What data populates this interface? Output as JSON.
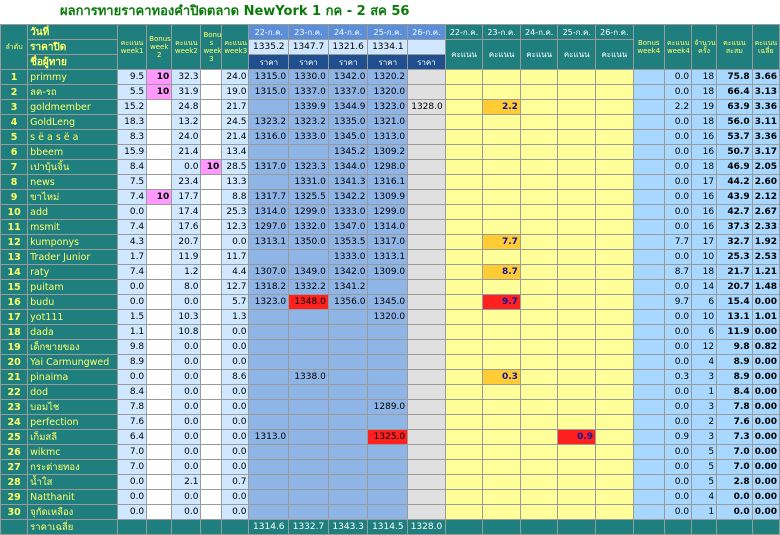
{
  "title": "ผลการทายราคาทองคำปิดตลาด NewYork 1 กค - 2 สค 56",
  "header": {
    "col_index": "ลำดับ",
    "row1_label": "วันที่",
    "row2_label": "ราคาปิด",
    "row3_label": "ชื่อผู้ทาย",
    "score_w1": "คะแนน week1",
    "bonus_w2": "Bonus week 2",
    "score_w2": "คะแนน week2",
    "bonus_w3": "Bonu s week 3",
    "score_w3": "คะแนน week3",
    "dates_w4": [
      "22-ก.ค.",
      "23-ก.ค.",
      "24-ก.ค.",
      "25-ก.ค.",
      "26-ก.ค."
    ],
    "close_w4": [
      "1335.2",
      "1347.7",
      "1321.6",
      "1334.1",
      ""
    ],
    "price_label": "ราคา",
    "dates_w5": [
      "22-ก.ค.",
      "23-ก.ค.",
      "24-ก.ค.",
      "25-ก.ค.",
      "26-ก.ค."
    ],
    "score_label": "คะแนน",
    "bonus_w4": "Bonus week4",
    "score_w4": "คะแนน week4",
    "count": "จำนวน ครั้ง",
    "total": "คะแนน สะสม",
    "avg": "คะแนน เฉลี่ย"
  },
  "rows": [
    {
      "n": "1",
      "name": "primmy",
      "w1": "9.5",
      "b2": "10",
      "w2": "32.3",
      "b3": "",
      "w3": "24.0",
      "p": [
        "1315.0",
        "1330.0",
        "1342.0",
        "1320.2",
        ""
      ],
      "s": [
        "",
        "",
        "",
        "",
        ""
      ],
      "b4": "",
      "w4": "0.0",
      "c": "18",
      "t": "75.8",
      "a": "3.66"
    },
    {
      "n": "2",
      "name": "ลค-รถ",
      "w1": "5.5",
      "b2": "10",
      "w2": "31.9",
      "b3": "",
      "w3": "19.0",
      "p": [
        "1315.0",
        "1337.0",
        "1337.0",
        "1320.0",
        ""
      ],
      "s": [
        "",
        "",
        "",
        "",
        ""
      ],
      "b4": "",
      "w4": "0.0",
      "c": "18",
      "t": "66.4",
      "a": "3.13"
    },
    {
      "n": "3",
      "name": "goldmember",
      "w1": "15.2",
      "b2": "",
      "w2": "24.8",
      "b3": "",
      "w3": "21.7",
      "p": [
        "",
        "1339.9",
        "1344.9",
        "1323.0",
        "1328.0"
      ],
      "s": [
        "",
        "2.2",
        "",
        "",
        ""
      ],
      "b4": "",
      "w4": "2.2",
      "c": "19",
      "t": "63.9",
      "a": "3.36"
    },
    {
      "n": "4",
      "name": "GoldLeng",
      "w1": "18.3",
      "b2": "",
      "w2": "13.2",
      "b3": "",
      "w3": "24.5",
      "p": [
        "1323.2",
        "1323.2",
        "1335.0",
        "1321.0",
        ""
      ],
      "s": [
        "",
        "",
        "",
        "",
        ""
      ],
      "b4": "",
      "w4": "0.0",
      "c": "18",
      "t": "56.0",
      "a": "3.11"
    },
    {
      "n": "5",
      "name": "s ë a s ë a",
      "w1": "8.3",
      "b2": "",
      "w2": "24.0",
      "b3": "",
      "w3": "21.4",
      "p": [
        "1316.0",
        "1333.0",
        "1345.0",
        "1313.0",
        ""
      ],
      "s": [
        "",
        "",
        "",
        "",
        ""
      ],
      "b4": "",
      "w4": "0.0",
      "c": "16",
      "t": "53.7",
      "a": "3.36"
    },
    {
      "n": "6",
      "name": "bbeem",
      "w1": "15.9",
      "b2": "",
      "w2": "21.4",
      "b3": "",
      "w3": "13.4",
      "p": [
        "",
        "",
        "1345.2",
        "1309.2",
        ""
      ],
      "s": [
        "",
        "",
        "",
        "",
        ""
      ],
      "b4": "",
      "w4": "0.0",
      "c": "16",
      "t": "50.7",
      "a": "3.17"
    },
    {
      "n": "7",
      "name": "เปาบุ้นจิ้น",
      "w1": "8.4",
      "b2": "",
      "w2": "0.0",
      "b3": "10",
      "w3": "28.5",
      "p": [
        "1317.0",
        "1323.3",
        "1344.0",
        "1298.0",
        ""
      ],
      "s": [
        "",
        "",
        "",
        "",
        ""
      ],
      "b4": "",
      "w4": "0.0",
      "c": "18",
      "t": "46.9",
      "a": "2.05"
    },
    {
      "n": "8",
      "name": "news",
      "w1": "7.5",
      "b2": "",
      "w2": "23.4",
      "b3": "",
      "w3": "13.3",
      "p": [
        "",
        "1331.0",
        "1341.3",
        "1316.1",
        ""
      ],
      "s": [
        "",
        "",
        "",
        "",
        ""
      ],
      "b4": "",
      "w4": "0.0",
      "c": "17",
      "t": "44.2",
      "a": "2.60"
    },
    {
      "n": "9",
      "name": "ขาไหม่",
      "w1": "7.4",
      "b2": "10",
      "w2": "17.7",
      "b3": "",
      "w3": "8.8",
      "p": [
        "1317.7",
        "1325.5",
        "1342.2",
        "1309.9",
        ""
      ],
      "s": [
        "",
        "",
        "",
        "",
        ""
      ],
      "b4": "",
      "w4": "0.0",
      "c": "16",
      "t": "43.9",
      "a": "2.12"
    },
    {
      "n": "10",
      "name": "add",
      "w1": "0.0",
      "b2": "",
      "w2": "17.4",
      "b3": "",
      "w3": "25.3",
      "p": [
        "1314.0",
        "1299.0",
        "1333.0",
        "1299.0",
        ""
      ],
      "s": [
        "",
        "",
        "",
        "",
        ""
      ],
      "b4": "",
      "w4": "0.0",
      "c": "16",
      "t": "42.7",
      "a": "2.67"
    },
    {
      "n": "11",
      "name": "msmit",
      "w1": "7.4",
      "b2": "",
      "w2": "17.6",
      "b3": "",
      "w3": "12.3",
      "p": [
        "1297.0",
        "1332.0",
        "1347.0",
        "1314.0",
        ""
      ],
      "s": [
        "",
        "",
        "",
        "",
        ""
      ],
      "b4": "",
      "w4": "0.0",
      "c": "16",
      "t": "37.3",
      "a": "2.33"
    },
    {
      "n": "12",
      "name": "kumponys",
      "w1": "4.3",
      "b2": "",
      "w2": "20.7",
      "b3": "",
      "w3": "0.0",
      "p": [
        "1313.1",
        "1350.0",
        "1353.5",
        "1317.0",
        ""
      ],
      "s": [
        "",
        "7.7",
        "",
        "",
        ""
      ],
      "b4": "",
      "w4": "7.7",
      "c": "17",
      "t": "32.7",
      "a": "1.92"
    },
    {
      "n": "13",
      "name": "Trader Junior",
      "w1": "1.7",
      "b2": "",
      "w2": "11.9",
      "b3": "",
      "w3": "11.7",
      "p": [
        "",
        "",
        "1333.0",
        "1313.1",
        ""
      ],
      "s": [
        "",
        "",
        "",
        "",
        ""
      ],
      "b4": "",
      "w4": "0.0",
      "c": "10",
      "t": "25.3",
      "a": "2.53"
    },
    {
      "n": "14",
      "name": "raty",
      "w1": "7.4",
      "b2": "",
      "w2": "1.2",
      "b3": "",
      "w3": "4.4",
      "p": [
        "1307.0",
        "1349.0",
        "1342.0",
        "1309.0",
        ""
      ],
      "s": [
        "",
        "8.7",
        "",
        "",
        ""
      ],
      "b4": "",
      "w4": "8.7",
      "c": "18",
      "t": "21.7",
      "a": "1.21"
    },
    {
      "n": "15",
      "name": "puitam",
      "w1": "0.0",
      "b2": "",
      "w2": "8.0",
      "b3": "",
      "w3": "12.7",
      "p": [
        "1318.2",
        "1332.2",
        "1341.2",
        "",
        ""
      ],
      "s": [
        "",
        "",
        "",
        "",
        ""
      ],
      "b4": "",
      "w4": "0.0",
      "c": "14",
      "t": "20.7",
      "a": "1.48"
    },
    {
      "n": "16",
      "name": "budu",
      "w1": "0.0",
      "b2": "",
      "w2": "0.0",
      "b3": "",
      "w3": "5.7",
      "p": [
        "1323.0",
        "1348.0",
        "1356.0",
        "1345.0",
        ""
      ],
      "s": [
        "",
        "9.7",
        "",
        "",
        ""
      ],
      "b4": "",
      "w4": "9.7",
      "c": "6",
      "t": "15.4",
      "a": "0.00"
    },
    {
      "n": "17",
      "name": "yot111",
      "w1": "1.5",
      "b2": "",
      "w2": "10.3",
      "b3": "",
      "w3": "1.3",
      "p": [
        "",
        "",
        "",
        "1320.0",
        ""
      ],
      "s": [
        "",
        "",
        "",
        "",
        ""
      ],
      "b4": "",
      "w4": "0.0",
      "c": "10",
      "t": "13.1",
      "a": "1.01"
    },
    {
      "n": "18",
      "name": "dada",
      "w1": "1.1",
      "b2": "",
      "w2": "10.8",
      "b3": "",
      "w3": "0.0",
      "p": [
        "",
        "",
        "",
        "",
        ""
      ],
      "s": [
        "",
        "",
        "",
        "",
        ""
      ],
      "b4": "",
      "w4": "0.0",
      "c": "6",
      "t": "11.9",
      "a": "0.00"
    },
    {
      "n": "19",
      "name": "เด็กขายของ",
      "w1": "9.8",
      "b2": "",
      "w2": "0.0",
      "b3": "",
      "w3": "0.0",
      "p": [
        "",
        "",
        "",
        "",
        ""
      ],
      "s": [
        "",
        "",
        "",
        "",
        ""
      ],
      "b4": "",
      "w4": "0.0",
      "c": "12",
      "t": "9.8",
      "a": "0.82"
    },
    {
      "n": "20",
      "name": "Yai Carmungwed",
      "w1": "8.9",
      "b2": "",
      "w2": "0.0",
      "b3": "",
      "w3": "0.0",
      "p": [
        "",
        "",
        "",
        "",
        ""
      ],
      "s": [
        "",
        "",
        "",
        "",
        ""
      ],
      "b4": "",
      "w4": "0.0",
      "c": "4",
      "t": "8.9",
      "a": "0.00"
    },
    {
      "n": "21",
      "name": "pinaima",
      "w1": "0.0",
      "b2": "",
      "w2": "0.0",
      "b3": "",
      "w3": "8.6",
      "p": [
        "",
        "1338.0",
        "",
        "",
        ""
      ],
      "s": [
        "",
        "0.3",
        "",
        "",
        ""
      ],
      "b4": "",
      "w4": "0.3",
      "c": "3",
      "t": "8.9",
      "a": "0.00"
    },
    {
      "n": "22",
      "name": "dod",
      "w1": "8.4",
      "b2": "",
      "w2": "0.0",
      "b3": "",
      "w3": "0.0",
      "p": [
        "",
        "",
        "",
        "",
        ""
      ],
      "s": [
        "",
        "",
        "",
        "",
        ""
      ],
      "b4": "",
      "w4": "0.0",
      "c": "1",
      "t": "8.4",
      "a": "0.00"
    },
    {
      "n": "23",
      "name": "บอมไช",
      "w1": "7.8",
      "b2": "",
      "w2": "0.0",
      "b3": "",
      "w3": "0.0",
      "p": [
        "",
        "",
        "",
        "1289.0",
        ""
      ],
      "s": [
        "",
        "",
        "",
        "",
        ""
      ],
      "b4": "",
      "w4": "0.0",
      "c": "3",
      "t": "7.8",
      "a": "0.00"
    },
    {
      "n": "24",
      "name": "perfection",
      "w1": "7.6",
      "b2": "",
      "w2": "0.0",
      "b3": "",
      "w3": "0.0",
      "p": [
        "",
        "",
        "",
        "",
        ""
      ],
      "s": [
        "",
        "",
        "",
        "",
        ""
      ],
      "b4": "",
      "w4": "0.0",
      "c": "2",
      "t": "7.6",
      "a": "0.00"
    },
    {
      "n": "25",
      "name": "เก็มสลี",
      "w1": "6.4",
      "b2": "",
      "w2": "0.0",
      "b3": "",
      "w3": "0.0",
      "p": [
        "1313.0",
        "",
        "",
        "1325.0",
        ""
      ],
      "s": [
        "",
        "",
        "",
        "0.9",
        ""
      ],
      "b4": "",
      "w4": "0.9",
      "c": "3",
      "t": "7.3",
      "a": "0.00"
    },
    {
      "n": "26",
      "name": "wikmc",
      "w1": "7.0",
      "b2": "",
      "w2": "0.0",
      "b3": "",
      "w3": "0.0",
      "p": [
        "",
        "",
        "",
        "",
        ""
      ],
      "s": [
        "",
        "",
        "",
        "",
        ""
      ],
      "b4": "",
      "w4": "0.0",
      "c": "5",
      "t": "7.0",
      "a": "0.00"
    },
    {
      "n": "27",
      "name": "กระต่ายทอง",
      "w1": "7.0",
      "b2": "",
      "w2": "0.0",
      "b3": "",
      "w3": "0.0",
      "p": [
        "",
        "",
        "",
        "",
        ""
      ],
      "s": [
        "",
        "",
        "",
        "",
        ""
      ],
      "b4": "",
      "w4": "0.0",
      "c": "5",
      "t": "7.0",
      "a": "0.00"
    },
    {
      "n": "28",
      "name": "น้ำใส",
      "w1": "0.0",
      "b2": "",
      "w2": "2.1",
      "b3": "",
      "w3": "0.7",
      "p": [
        "",
        "",
        "",
        "",
        ""
      ],
      "s": [
        "",
        "",
        "",
        "",
        ""
      ],
      "b4": "",
      "w4": "0.0",
      "c": "5",
      "t": "2.8",
      "a": "0.00"
    },
    {
      "n": "29",
      "name": "Natthanit",
      "w1": "0.0",
      "b2": "",
      "w2": "0.0",
      "b3": "",
      "w3": "0.0",
      "p": [
        "",
        "",
        "",
        "",
        ""
      ],
      "s": [
        "",
        "",
        "",
        "",
        ""
      ],
      "b4": "",
      "w4": "0.0",
      "c": "4",
      "t": "0.0",
      "a": "0.00"
    },
    {
      "n": "30",
      "name": "จุกัดเหลือง",
      "w1": "0.0",
      "b2": "",
      "w2": "0.0",
      "b3": "",
      "w3": "0.0",
      "p": [
        "",
        "",
        "",
        "",
        ""
      ],
      "s": [
        "",
        "",
        "",
        "",
        ""
      ],
      "b4": "",
      "w4": "0.0",
      "c": "1",
      "t": "0.0",
      "a": "0.00"
    }
  ],
  "footer": {
    "label": "ราคาเฉลี่ย",
    "avg_prices": [
      "1314.6",
      "1332.7",
      "1343.3",
      "1314.5",
      "1328.0"
    ]
  },
  "highlights": {
    "price_red": [
      {
        "row": 16,
        "col": 1
      },
      {
        "row": 25,
        "col": 3
      }
    ],
    "score_orange": [
      {
        "row": 3,
        "col": 1
      },
      {
        "row": 12,
        "col": 1
      },
      {
        "row": 14,
        "col": 1
      },
      {
        "row": 21,
        "col": 1
      }
    ],
    "score_red": [
      {
        "row": 16,
        "col": 1
      },
      {
        "row": 25,
        "col": 3
      }
    ],
    "colors": {
      "teal": "#1f7f7f",
      "yellow_text": "#ffff66",
      "price_blue": "#8fb4e6",
      "score_yellow": "#ffff99",
      "red": "#ff2020",
      "orange": "#ffcc33",
      "pink": "#ff99ff",
      "light_blue": "#a8d8ff"
    }
  }
}
